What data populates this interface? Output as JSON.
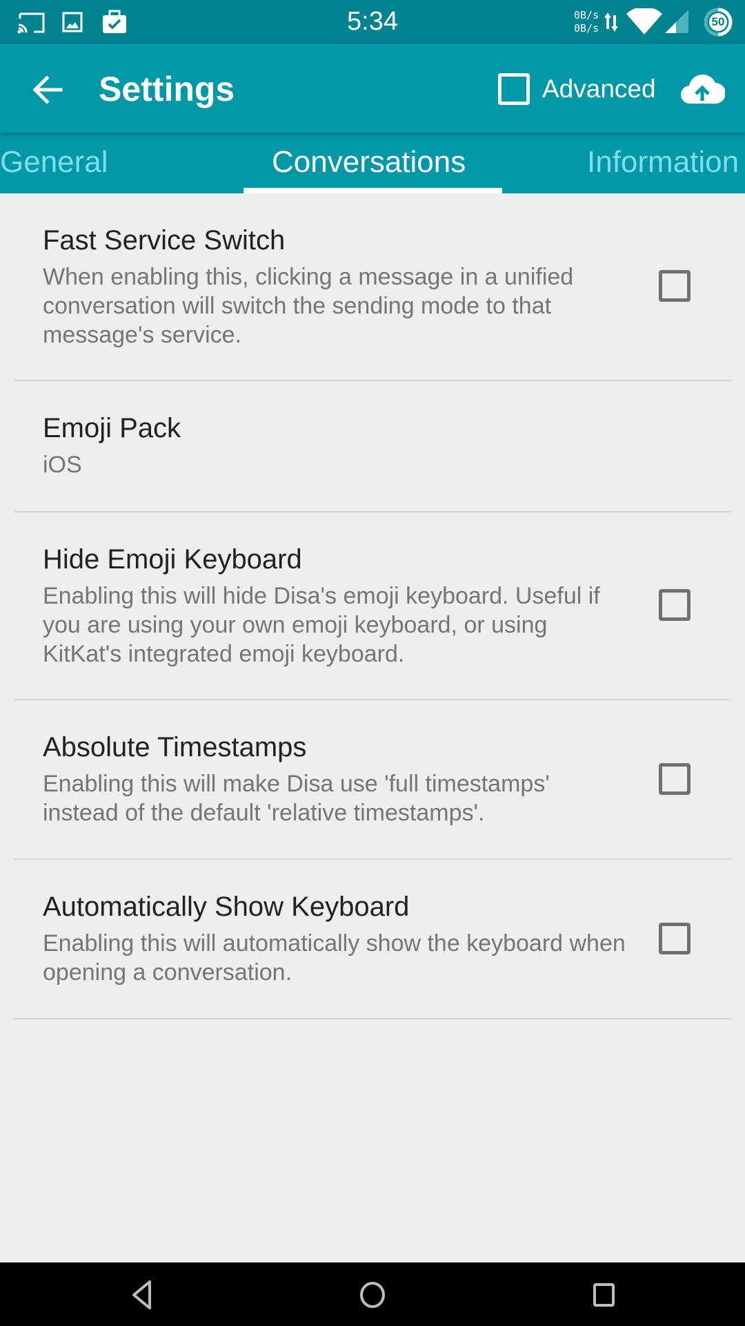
{
  "status_bar": {
    "time": "5:34",
    "net_up": "0B/s",
    "net_down": "0B/s",
    "battery_level": "50",
    "icons": [
      "cast-icon",
      "image-icon",
      "briefcase-check-icon",
      "data-transfer-icon",
      "wifi-icon",
      "cell-signal-icon",
      "battery-circle-icon"
    ]
  },
  "app_bar": {
    "title": "Settings",
    "back_icon": "arrow-left-icon",
    "advanced_label": "Advanced",
    "advanced_checked": false,
    "upload_icon": "cloud-upload-icon"
  },
  "tabs": [
    {
      "label": "General",
      "active": false
    },
    {
      "label": "Conversations",
      "active": true
    },
    {
      "label": "Information",
      "active": false
    }
  ],
  "preferences": [
    {
      "title": "Fast Service Switch",
      "summary": "When enabling this, clicking a message in a unified conversation will switch the sending mode to that message's service.",
      "has_checkbox": true,
      "checked": false
    },
    {
      "title": "Emoji Pack",
      "summary": "iOS",
      "has_checkbox": false
    },
    {
      "title": "Hide Emoji Keyboard",
      "summary": "Enabling this will hide Disa's emoji keyboard. Useful if you are using your own emoji keyboard, or using KitKat's integrated emoji keyboard.",
      "has_checkbox": true,
      "checked": false
    },
    {
      "title": "Absolute Timestamps",
      "summary": "Enabling this will make Disa use 'full timestamps' instead of the default 'relative timestamps'.",
      "has_checkbox": true,
      "checked": false
    },
    {
      "title": "Automatically Show Keyboard",
      "summary": "Enabling this will automatically show the keyboard when opening a conversation.",
      "has_checkbox": true,
      "checked": false
    }
  ],
  "nav_bar": {
    "buttons": [
      "back-triangle-icon",
      "home-circle-icon",
      "recents-square-icon"
    ]
  },
  "colors": {
    "status_bar": "#00838f",
    "primary": "#0097a7",
    "tab_inactive": "#80deea",
    "background": "#eeeeee",
    "title_text": "#212121",
    "summary_text": "#757575"
  }
}
